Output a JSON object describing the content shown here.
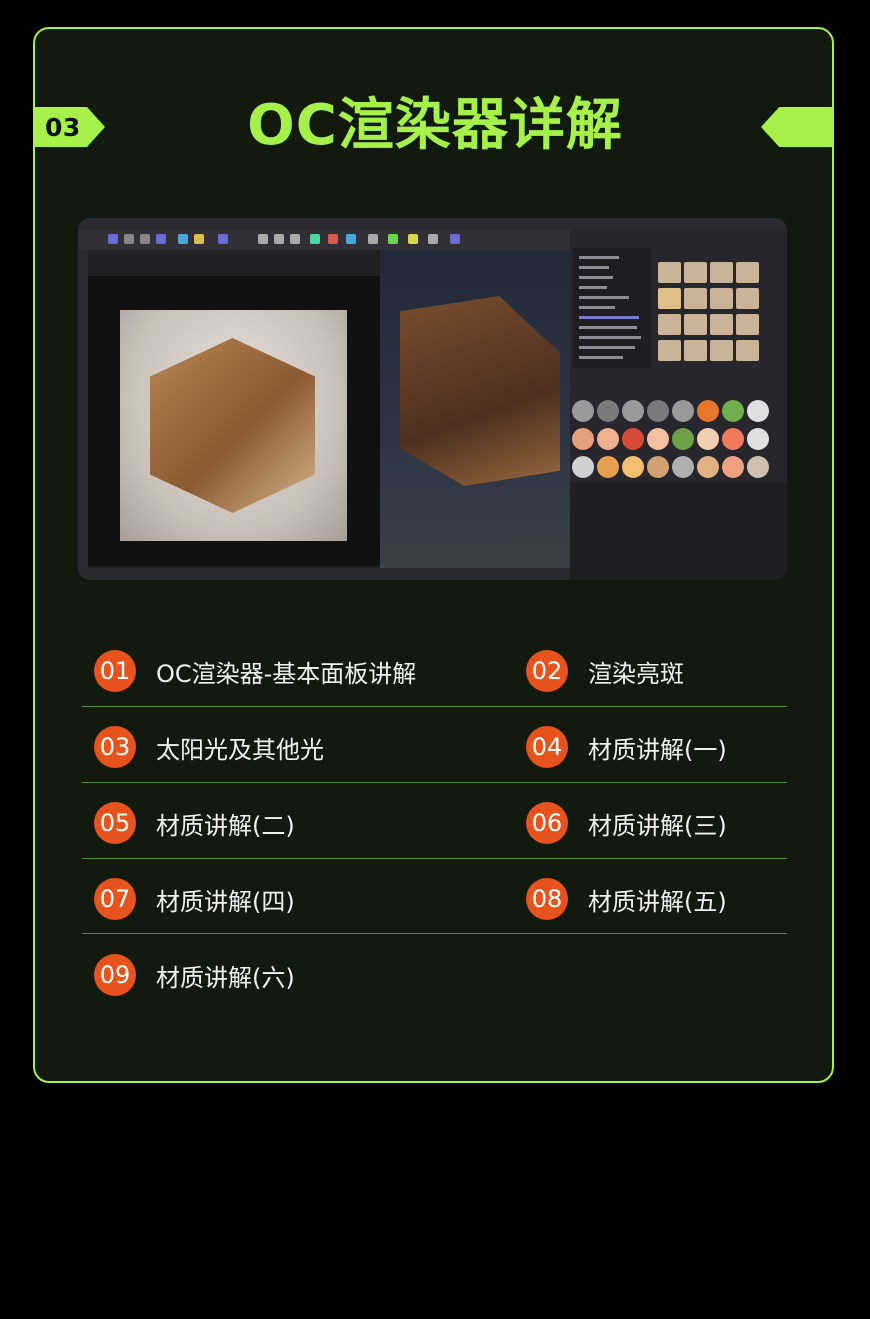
{
  "section": {
    "number": "03",
    "title": "OC渲染器详解"
  },
  "lessons": [
    {
      "num": "01",
      "label": "OC渲染器-基本面板讲解"
    },
    {
      "num": "02",
      "label": "渲染亮斑"
    },
    {
      "num": "03",
      "label": "太阳光及其他光"
    },
    {
      "num": "04",
      "label": "材质讲解(一)"
    },
    {
      "num": "05",
      "label": "材质讲解(二)"
    },
    {
      "num": "06",
      "label": "材质讲解(三)"
    },
    {
      "num": "07",
      "label": "材质讲解(四)"
    },
    {
      "num": "08",
      "label": "材质讲解(五)"
    },
    {
      "num": "09",
      "label": "材质讲解(六)"
    }
  ],
  "colors": {
    "accent": "#a6f04a",
    "badge": "#e7531c",
    "card_bg": "#121a10"
  }
}
